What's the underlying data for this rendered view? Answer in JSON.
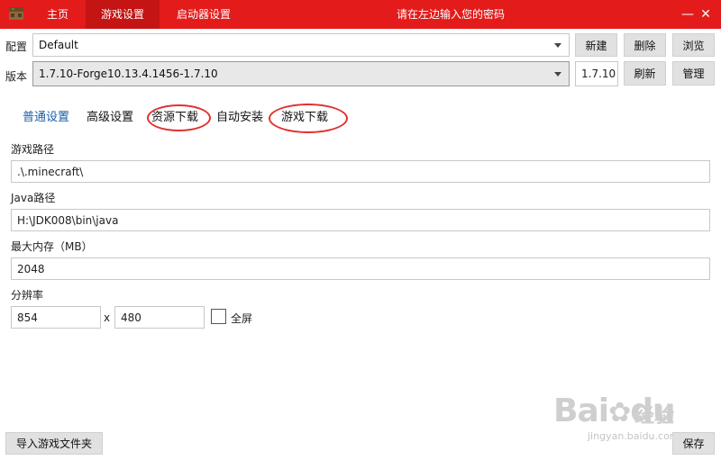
{
  "titlebar": {
    "tabs": [
      {
        "label": "主页"
      },
      {
        "label": "游戏设置"
      },
      {
        "label": "启动器设置"
      }
    ],
    "title": "请在左边输入您的密码",
    "minimize": "—",
    "close": "✕"
  },
  "profile": {
    "label": "配置",
    "value": "Default",
    "new_label": "新建",
    "delete_label": "删除",
    "browse_label": "浏览"
  },
  "version": {
    "label": "版本",
    "value": "1.7.10-Forge10.13.4.1456-1.7.10",
    "short": "1.7.10",
    "refresh_label": "刷新",
    "manage_label": "管理"
  },
  "subtabs": [
    {
      "label": "普通设置"
    },
    {
      "label": "高级设置"
    },
    {
      "label": "资源下载"
    },
    {
      "label": "自动安装"
    },
    {
      "label": "游戏下载"
    }
  ],
  "form": {
    "game_path_label": "游戏路径",
    "game_path_value": ".\\.minecraft\\",
    "java_path_label": "Java路径",
    "java_path_value": "H:\\JDK008\\bin\\java",
    "memory_label": "最大内存（MB）",
    "memory_value": "2048",
    "resolution_label": "分辨率",
    "width_value": "854",
    "times": "x",
    "height_value": "480",
    "fullscreen_label": "全屏"
  },
  "footer": {
    "import_label": "导入游戏文件夹",
    "save_label": "保存"
  },
  "watermark": {
    "brand": "Bai",
    "du": "du",
    "jingyan": "经验",
    "url": "jingyan.baidu.com"
  },
  "colors": {
    "titlebar": "#e31b1b",
    "active_tab": "#c41414",
    "active_subtab": "#1b5ea6",
    "circle": "#e0322e"
  }
}
